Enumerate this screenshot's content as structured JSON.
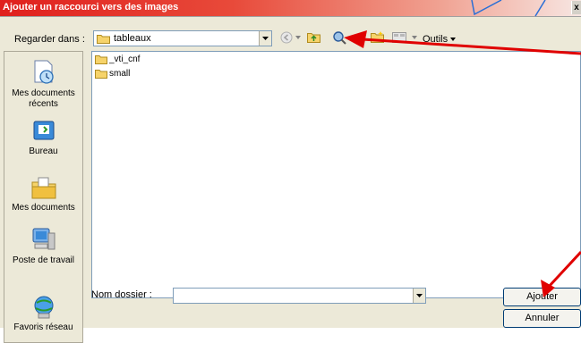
{
  "window": {
    "title": "Ajouter un raccourci vers des images",
    "close": "x"
  },
  "toolbar": {
    "look_in_label": "Regarder dans :",
    "look_in_value": "tableaux",
    "tools_label": "Outils"
  },
  "places": [
    {
      "label": "Mes documents récents",
      "icon": "recent-documents-icon"
    },
    {
      "label": "Bureau",
      "icon": "desktop-icon"
    },
    {
      "label": "Mes documents",
      "icon": "my-documents-icon"
    },
    {
      "label": "Poste de travail",
      "icon": "my-computer-icon"
    },
    {
      "label": "Favoris réseau",
      "icon": "network-places-icon"
    }
  ],
  "files": [
    {
      "name": "_vti_cnf",
      "icon": "folder-icon"
    },
    {
      "name": "small",
      "icon": "folder-icon"
    }
  ],
  "footer": {
    "folder_name_label": "Nom dossier :",
    "folder_name_value": "",
    "add_button": "Ajouter",
    "cancel_button": "Annuler"
  },
  "colors": {
    "title_gradient_start": "#e0201d",
    "dialog_bg": "#ece9d8",
    "annotation_arrow": "#e00000",
    "annotation_line": "#2a6fd6"
  }
}
